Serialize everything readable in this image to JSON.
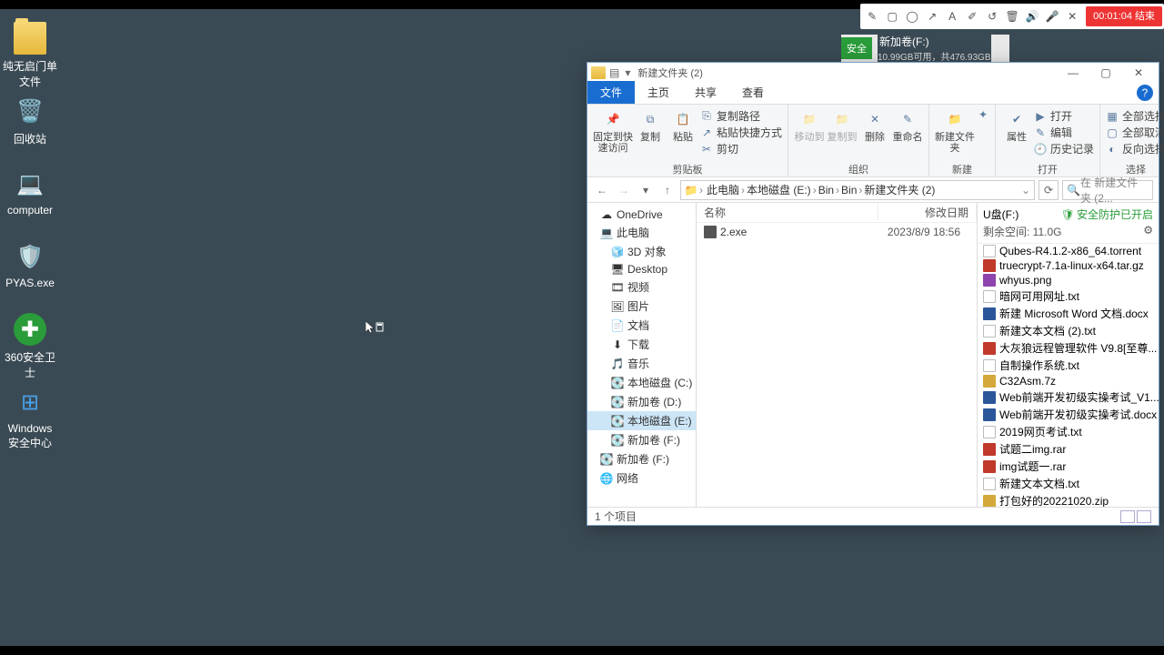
{
  "desktop_icons": [
    {
      "label": "纯无启门单文件",
      "type": "folder"
    },
    {
      "label": "回收站",
      "type": "bin"
    },
    {
      "label": "computer",
      "type": "pc"
    },
    {
      "label": "PYAS.exe",
      "type": "shield"
    },
    {
      "label": "360安全卫士",
      "type": "sec"
    },
    {
      "label": "Windows 安全中心",
      "type": "win"
    }
  ],
  "toolbar": {
    "timer": "00:01:04 结束"
  },
  "drivebox": {
    "badge": "安全",
    "title": "新加卷(F:)",
    "sub": "10.99GB可用，共476.93GB"
  },
  "explorer": {
    "title": "新建文件夹 (2)",
    "tabs": {
      "file": "文件",
      "home": "主页",
      "share": "共享",
      "view": "查看"
    },
    "ribbon": {
      "pin": "固定到快速访问",
      "copy": "复制",
      "paste": "粘贴",
      "copypath": "复制路径",
      "pasteshortcut": "粘贴快捷方式",
      "cut": "剪切",
      "moveto": "移动到",
      "copyto": "复制到",
      "delete": "删除",
      "rename": "重命名",
      "newfolder": "新建文件夹",
      "newitem": "新建项目",
      "properties": "属性",
      "open": "打开",
      "edit": "编辑",
      "history": "历史记录",
      "selectall": "全部选择",
      "selectnone": "全部取消",
      "invert": "反向选择",
      "g_clip": "剪贴板",
      "g_org": "组织",
      "g_new": "新建",
      "g_open": "打开",
      "g_sel": "选择"
    },
    "breadcrumb": [
      "此电脑",
      "本地磁盘 (E:)",
      "Bin",
      "Bin",
      "新建文件夹 (2)"
    ],
    "search_ph": "在 新建文件夹 (2...",
    "nav": [
      {
        "l": "OneDrive",
        "lvl": 1,
        "ico": "☁"
      },
      {
        "l": "此电脑",
        "lvl": 1,
        "ico": "💻"
      },
      {
        "l": "3D 对象",
        "lvl": 2,
        "ico": "🧊"
      },
      {
        "l": "Desktop",
        "lvl": 2,
        "ico": "🖥"
      },
      {
        "l": "视频",
        "lvl": 2,
        "ico": "🎞"
      },
      {
        "l": "图片",
        "lvl": 2,
        "ico": "🖼"
      },
      {
        "l": "文档",
        "lvl": 2,
        "ico": "📄"
      },
      {
        "l": "下载",
        "lvl": 2,
        "ico": "⬇"
      },
      {
        "l": "音乐",
        "lvl": 2,
        "ico": "🎵"
      },
      {
        "l": "本地磁盘 (C:)",
        "lvl": 2,
        "ico": "💽"
      },
      {
        "l": "新加卷 (D:)",
        "lvl": 2,
        "ico": "💽"
      },
      {
        "l": "本地磁盘 (E:)",
        "lvl": 2,
        "ico": "💽",
        "sel": true
      },
      {
        "l": "新加卷 (F:)",
        "lvl": 2,
        "ico": "💽"
      },
      {
        "l": "新加卷 (F:)",
        "lvl": 1,
        "ico": "💽"
      },
      {
        "l": "网络",
        "lvl": 1,
        "ico": "🌐"
      }
    ],
    "cols": {
      "name": "名称",
      "date": "修改日期"
    },
    "files": [
      {
        "name": "2.exe",
        "date": "2023/8/9 18:56",
        "ico": "exe"
      }
    ],
    "side": {
      "drive": "U盘(F:)",
      "protect": "安全防护已开启",
      "space": "剩余空间: 11.0G",
      "items": [
        {
          "n": "Qubes-R4.1.2-x86_64.torrent",
          "t": "tor"
        },
        {
          "n": "truecrypt-7.1a-linux-x64.tar.gz",
          "t": "rar"
        },
        {
          "n": "whyus.png",
          "t": "png"
        },
        {
          "n": "暗网可用网址.txt",
          "t": "txt"
        },
        {
          "n": "新建 Microsoft Word 文档.docx",
          "t": "doc"
        },
        {
          "n": "新建文本文档 (2).txt",
          "t": "txt"
        },
        {
          "n": "大灰狼远程管理软件 V9.8[至尊...",
          "t": "rar"
        },
        {
          "n": "自制操作系统.txt",
          "t": "txt"
        },
        {
          "n": "C32Asm.7z",
          "t": "zip"
        },
        {
          "n": "Web前端开发初级实操考试_V1....",
          "t": "doc"
        },
        {
          "n": "Web前端开发初级实操考试.docx",
          "t": "doc"
        },
        {
          "n": "2019网页考试.txt",
          "t": "txt"
        },
        {
          "n": "试题二img.rar",
          "t": "rar"
        },
        {
          "n": "img试题一.rar",
          "t": "rar"
        },
        {
          "n": "新建文本文档.txt",
          "t": "txt"
        },
        {
          "n": "打包好的20221020.zip",
          "t": "zip"
        }
      ]
    },
    "status": "1 个项目"
  }
}
